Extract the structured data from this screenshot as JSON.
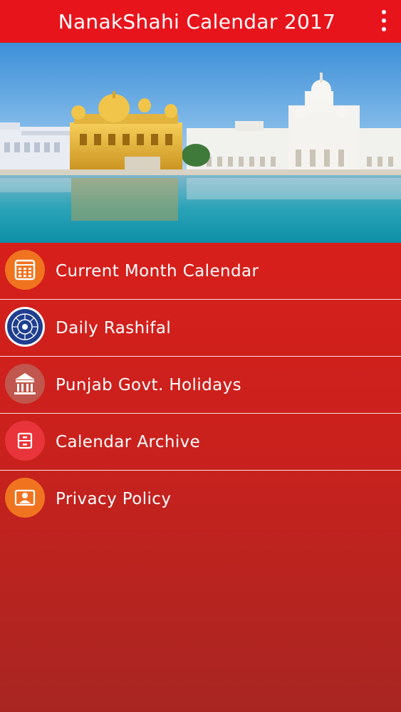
{
  "app_bar": {
    "title": "NanakShahi Calendar 2017",
    "overflow_icon": "more-vertical-icon"
  },
  "banner": {
    "subject": "golden-temple-image"
  },
  "menu": {
    "items": [
      {
        "label": "Current Month Calendar",
        "icon": "calendar-icon",
        "icon_color": "#f07420"
      },
      {
        "label": "Daily Rashifal",
        "icon": "zodiac-wheel-icon",
        "icon_color": "#1f3e8f"
      },
      {
        "label": "Punjab Govt. Holidays",
        "icon": "government-building-icon",
        "icon_color": "#c0564d"
      },
      {
        "label": "Calendar Archive",
        "icon": "archive-icon",
        "icon_color": "#e8343a"
      },
      {
        "label": "Privacy Policy",
        "icon": "contact-card-icon",
        "icon_color": "#f07420"
      }
    ]
  },
  "colors": {
    "app_bar": "#e8141c",
    "menu_top": "#d71f1b",
    "menu_bottom": "#a82622",
    "text": "#ffffff"
  }
}
